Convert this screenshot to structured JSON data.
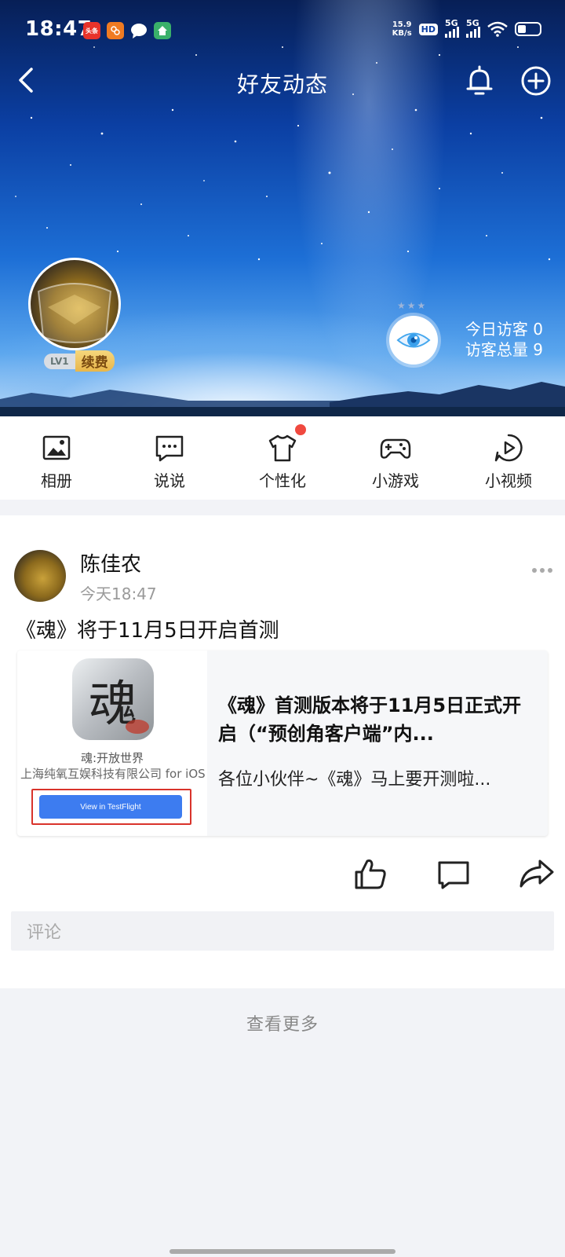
{
  "status_bar": {
    "time": "18:47",
    "notifications": [
      {
        "name": "toutiao",
        "text": "头条",
        "color": "#e8332a"
      },
      {
        "name": "app-orange",
        "text": "",
        "color": "#f07b22"
      },
      {
        "name": "message",
        "text": "",
        "color": "#ffffff"
      },
      {
        "name": "app-green",
        "text": "",
        "color": "#3ab06a"
      }
    ],
    "net_speed_value": "15.9",
    "net_speed_unit": "KB/s",
    "hd_label": "HD",
    "signal1_label": "5G",
    "signal2_label": "5G"
  },
  "header": {
    "title": "好友动态"
  },
  "profile": {
    "level": "LV1",
    "renew_label": "续费",
    "visitors_today": "今日访客 0",
    "visitors_total": "访客总量 9"
  },
  "features": [
    {
      "id": "album",
      "label": "相册",
      "icon": "image-icon"
    },
    {
      "id": "talk",
      "label": "说说",
      "icon": "chat-bubble-icon"
    },
    {
      "id": "personalize",
      "label": "个性化",
      "icon": "tshirt-icon",
      "has_dot": true
    },
    {
      "id": "games",
      "label": "小游戏",
      "icon": "gamepad-icon"
    },
    {
      "id": "video",
      "label": "小视频",
      "icon": "play-circle-icon"
    }
  ],
  "post": {
    "author": "陈佳农",
    "time": "今天18:47",
    "text": "《魂》将于11月5日开启首测",
    "share": {
      "app_icon_char": "魂",
      "app_name": "魂:开放世界",
      "app_developer": "上海纯氧互娱科技有限公司 for iOS",
      "testflight_label": "View in TestFlight",
      "title": "《魂》首测版本将于11月5日正式开启（“预创角客户端”内...",
      "description": "各位小伙伴~《魂》马上要开测啦..."
    },
    "comment_placeholder": "评论"
  },
  "see_more": "查看更多",
  "colors": {
    "accent_blue": "#3d7cf0",
    "badge_red": "#f0493f",
    "renew_gold": "#e8b64a"
  }
}
